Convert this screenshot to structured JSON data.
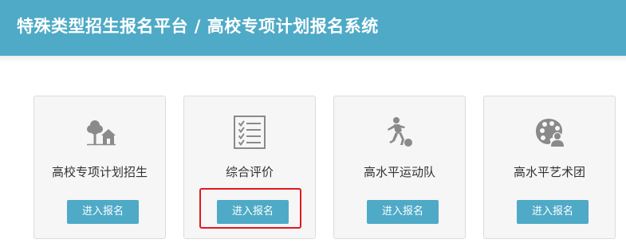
{
  "header": {
    "title": "特殊类型招生报名平台 / 高校专项计划报名系统"
  },
  "colors": {
    "accent": "#4eaac6",
    "icon": "#8a8a8a",
    "highlight": "#e0191e"
  },
  "cards": [
    {
      "title": "高校专项计划招生",
      "button": "进入报名",
      "icon": "tree-house-icon"
    },
    {
      "title": "综合评价",
      "button": "进入报名",
      "icon": "checklist-icon"
    },
    {
      "title": "高水平运动队",
      "button": "进入报名",
      "icon": "soccer-player-icon"
    },
    {
      "title": "高水平艺术团",
      "button": "进入报名",
      "icon": "palette-icon"
    }
  ]
}
